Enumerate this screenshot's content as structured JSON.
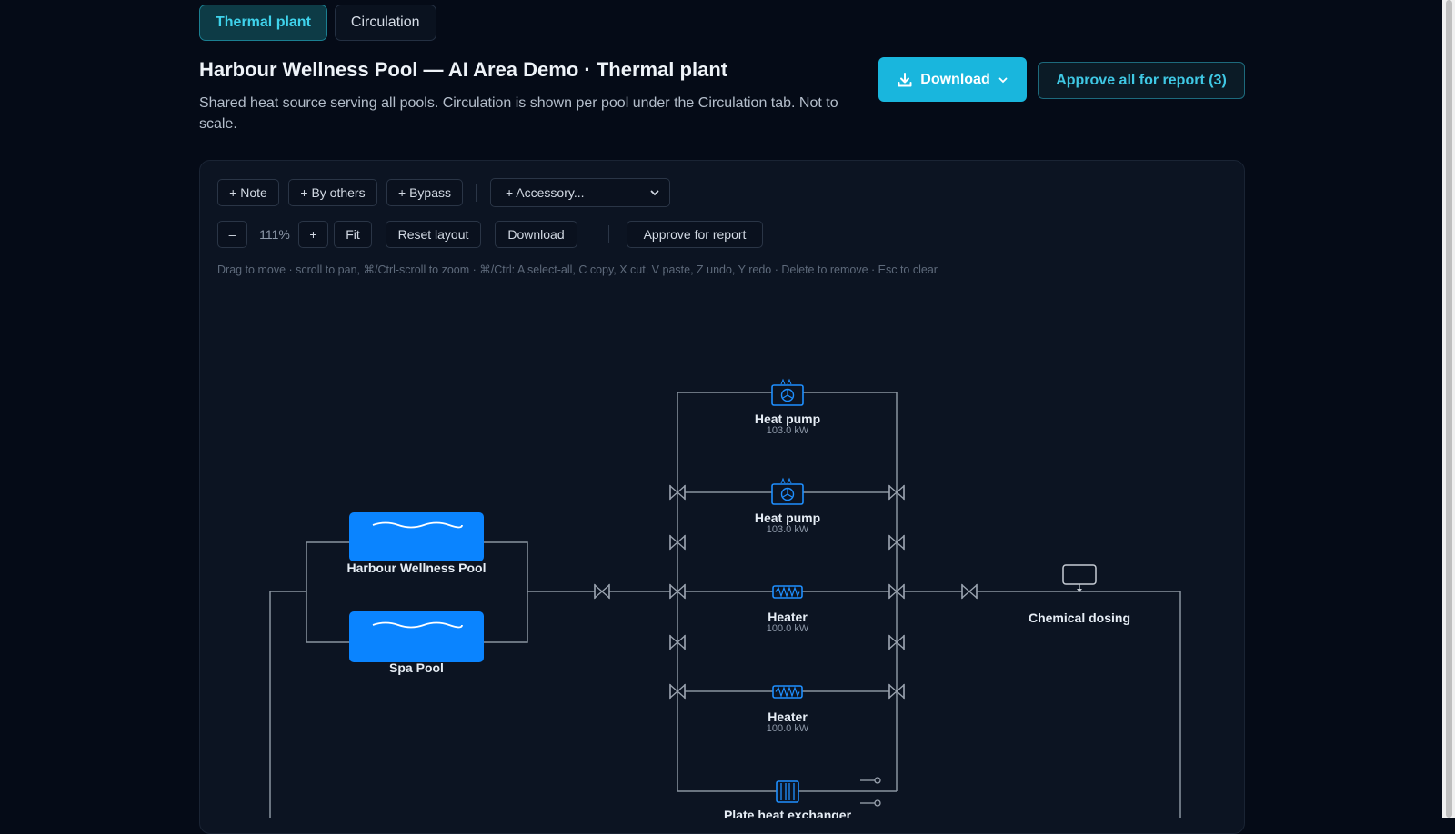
{
  "tabs": [
    {
      "label": "Thermal plant",
      "active": true
    },
    {
      "label": "Circulation",
      "active": false
    }
  ],
  "header": {
    "title": "Harbour Wellness Pool — AI Area Demo · Thermal plant",
    "subtitle": "Shared heat source serving all pools. Circulation is shown per pool under the Circulation tab. Not to scale.",
    "download_label": "Download",
    "approve_all_label": "Approve all for report (3)"
  },
  "toolbar": {
    "note": "+ Note",
    "by_others": "+ By others",
    "bypass": "+ Bypass",
    "accessory_placeholder": "+ Accessory...",
    "zoom_out": "–",
    "zoom_level": "111%",
    "zoom_in": "+",
    "fit": "Fit",
    "reset_layout": "Reset layout",
    "download": "Download",
    "approve": "Approve for report",
    "help": "Drag to move · scroll to pan, ⌘/Ctrl-scroll to zoom · ⌘/Ctrl: A select-all, C copy, X cut, V paste, Z undo, Y redo · Delete to remove · Esc to clear"
  },
  "diagram": {
    "pools": [
      {
        "name": "Harbour Wellness Pool"
      },
      {
        "name": "Spa Pool"
      }
    ],
    "equipment": [
      {
        "name": "Heat pump",
        "rating": "103.0 kW",
        "icon": "heat-pump-icon"
      },
      {
        "name": "Heat pump",
        "rating": "103.0 kW",
        "icon": "heat-pump-icon"
      },
      {
        "name": "Heater",
        "rating": "100.0 kW",
        "icon": "heater-icon"
      },
      {
        "name": "Heater",
        "rating": "100.0 kW",
        "icon": "heater-icon"
      },
      {
        "name": "Plate heat exchanger",
        "rating": "",
        "icon": "plate-heat-exchanger-icon"
      }
    ],
    "dosing": {
      "name": "Chemical dosing",
      "icon": "chemical-dosing-icon"
    },
    "colors": {
      "pipe": "#8a93a0",
      "equipment": "#1e8fff",
      "pool": "#0a84ff"
    }
  }
}
